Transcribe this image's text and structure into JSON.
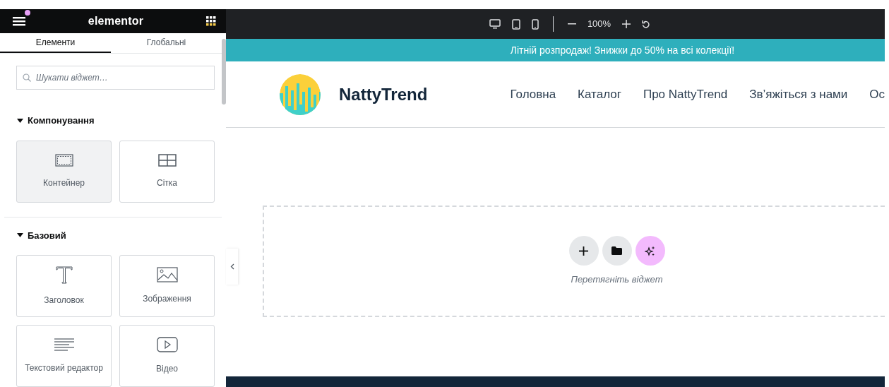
{
  "panel": {
    "brand": "elementor",
    "notification": true,
    "tabs": [
      {
        "label": "Елементи",
        "selected": true
      },
      {
        "label": "Глобальні",
        "selected": false
      }
    ],
    "search": {
      "placeholder": "Шукати віджет…"
    },
    "sections": [
      {
        "title": "Компонування",
        "expanded": true,
        "widgets": [
          {
            "label": "Контейнер",
            "kind": "container",
            "selected": true
          },
          {
            "label": "Сітка",
            "kind": "grid",
            "selected": false
          }
        ]
      },
      {
        "title": "Базовий",
        "expanded": true,
        "widgets": [
          {
            "label": "Заголовок",
            "kind": "heading",
            "selected": false
          },
          {
            "label": "Зображення",
            "kind": "image",
            "selected": false
          },
          {
            "label": "Текстовий редактор",
            "kind": "text",
            "selected": false
          },
          {
            "label": "Відео",
            "kind": "video",
            "selected": false
          }
        ]
      }
    ]
  },
  "toolbar": {
    "devices": [
      {
        "kind": "desktop"
      },
      {
        "kind": "tablet"
      },
      {
        "kind": "mobile"
      }
    ],
    "zoom": "100%"
  },
  "site": {
    "announcement": "Літній розпродаж! Знижки до 50% на всі колекції!",
    "brand": "NattyTrend",
    "nav": [
      "Головна",
      "Каталог",
      "Про NattyTrend",
      "Зв’яжіться з нами",
      "Ос"
    ],
    "dropzone": {
      "hint": "Перетягніть віджет"
    }
  }
}
